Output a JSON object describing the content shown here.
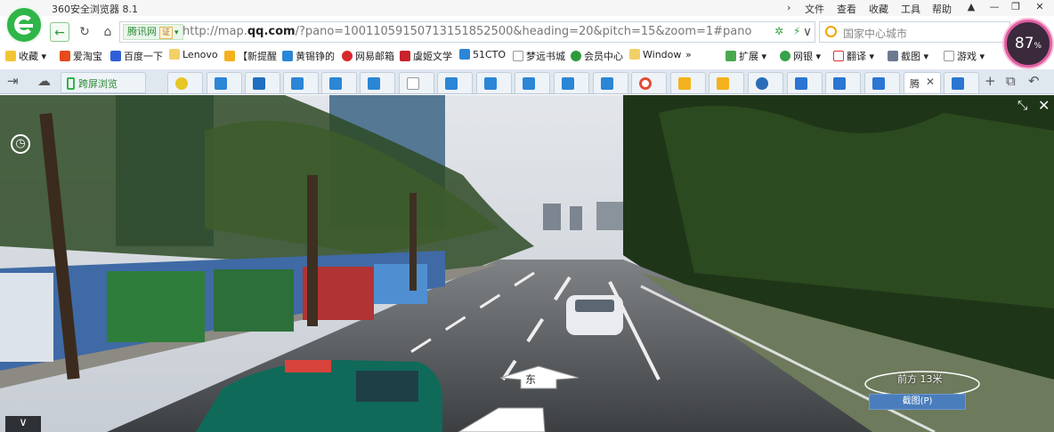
{
  "window": {
    "app_title": "360安全浏览器 8.1",
    "menus": [
      "文件",
      "查看",
      "收藏",
      "工具",
      "帮助"
    ]
  },
  "nav": {
    "site_badge": "腾讯网",
    "cert_badge": "证",
    "url_prefix": "http://map.",
    "url_domain": "qq.com",
    "url_rest": "/?pano=10011059150713151852500&heading=20&pitch=15&zoom=1#pano=10(",
    "search_placeholder": "国家中心城市"
  },
  "perf": {
    "value": "87",
    "unit": "%"
  },
  "bookmarks": [
    {
      "label": "收藏"
    },
    {
      "label": "爱淘宝"
    },
    {
      "label": "百度一下"
    },
    {
      "label": "Lenovo"
    },
    {
      "label": "【新提醒"
    },
    {
      "label": "黄锡铮的"
    },
    {
      "label": "网易邮箱"
    },
    {
      "label": "虞姬文学"
    },
    {
      "label": "51CTO"
    },
    {
      "label": "梦远书城"
    },
    {
      "label": "会员中心"
    },
    {
      "label": "Window"
    },
    {
      "label": "扩展"
    },
    {
      "label": "网银"
    },
    {
      "label": "翻译"
    },
    {
      "label": "截图"
    },
    {
      "label": "游戏"
    }
  ],
  "tabstrip": {
    "cast_label": "跨屏浏览",
    "active_tab_label": "腾"
  },
  "streetview": {
    "direction": "东",
    "distance": "前方 13米",
    "screenshot_button": "截图(P)"
  },
  "colors": {
    "accent_green": "#2fb548",
    "gauge_ring": "#e25da1",
    "screenshot_button": "#4a7dbb"
  }
}
